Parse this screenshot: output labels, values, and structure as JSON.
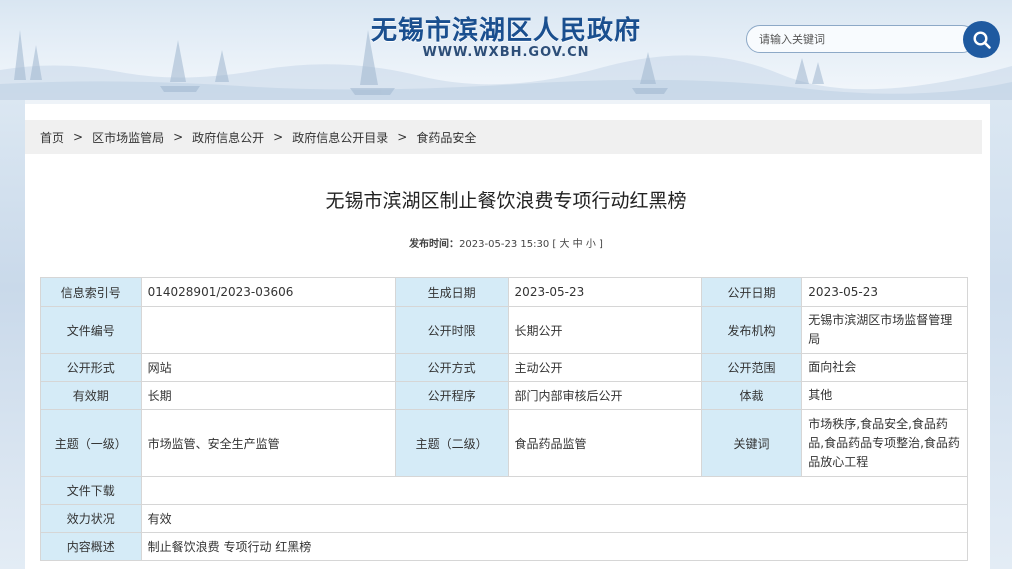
{
  "header": {
    "site_title": "无锡市滨湖区人民政府",
    "site_url": "WWW.WXBH.GOV.CN",
    "search_placeholder": "请输入关键词"
  },
  "breadcrumb": [
    "首页",
    "区市场监管局",
    "政府信息公开",
    "政府信息公开目录",
    "食药品安全"
  ],
  "breadcrumb_separator": ">",
  "article": {
    "title": "无锡市滨湖区制止餐饮浪费专项行动红黑榜",
    "publish_label": "发布时间：",
    "publish_time": "2023-05-23 15:30",
    "font_size_open": "[",
    "font_large": "大",
    "font_medium": "中",
    "font_small": "小",
    "font_size_close": "]"
  },
  "info": {
    "index_no_label": "信息索引号",
    "index_no": "014028901/2023-03606",
    "gen_date_label": "生成日期",
    "gen_date": "2023-05-23",
    "pub_date_label": "公开日期",
    "pub_date": "2023-05-23",
    "doc_no_label": "文件编号",
    "doc_no": "",
    "time_limit_label": "公开时限",
    "time_limit": "长期公开",
    "org_label": "发布机构",
    "org": "无锡市滨湖区市场监督管理局",
    "form_label": "公开形式",
    "form": "网站",
    "method_label": "公开方式",
    "method": "主动公开",
    "scope_label": "公开范围",
    "scope": "面向社会",
    "validity_label": "有效期",
    "validity": "长期",
    "procedure_label": "公开程序",
    "procedure": "部门内部审核后公开",
    "genre_label": "体裁",
    "genre": "其他",
    "topic1_label": "主题（一级）",
    "topic1": "市场监管、安全生产监管",
    "topic2_label": "主题（二级）",
    "topic2": "食品药品监管",
    "keywords_label": "关键词",
    "keywords": "市场秩序,食品安全,食品药品,食品药品专项整治,食品药品放心工程",
    "download_label": "文件下载",
    "download": "",
    "status_label": "效力状况",
    "status": "有效",
    "summary_label": "内容概述",
    "summary": "制止餐饮浪费 专项行动 红黑榜"
  },
  "colors": {
    "title_blue": "#1a4f8f",
    "search_button": "#1f5aa0",
    "label_cell_bg": "#d5ebf7",
    "breadcrumb_bg": "#f0f0f0"
  },
  "icons": {
    "search": "search-icon"
  }
}
